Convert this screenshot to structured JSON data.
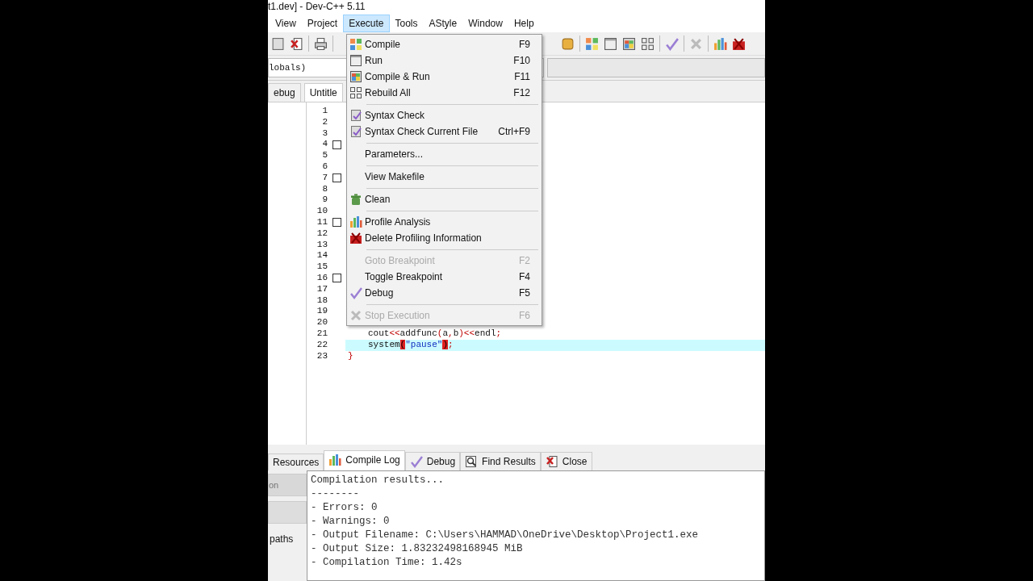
{
  "window": {
    "title": "t1.dev] - Dev-C++ 5.11"
  },
  "menu_bar": [
    {
      "label": "View",
      "selected": false
    },
    {
      "label": "Project",
      "selected": false
    },
    {
      "label": "Execute",
      "selected": true
    },
    {
      "label": "Tools",
      "selected": false
    },
    {
      "label": "AStyle",
      "selected": false
    },
    {
      "label": "Window",
      "selected": false
    },
    {
      "label": "Help",
      "selected": false
    }
  ],
  "scope_box": {
    "value": "lobals)"
  },
  "editor_tabs": [
    {
      "label": "ebug",
      "selected": false
    },
    {
      "label": "Untitle",
      "selected": true
    }
  ],
  "execute_menu": [
    {
      "kind": "item",
      "label": "Compile",
      "shortcut": "F9",
      "disabled": false
    },
    {
      "kind": "item",
      "label": "Run",
      "shortcut": "F10",
      "disabled": false
    },
    {
      "kind": "item",
      "label": "Compile & Run",
      "shortcut": "F11",
      "disabled": false
    },
    {
      "kind": "item",
      "label": "Rebuild All",
      "shortcut": "F12",
      "disabled": false
    },
    {
      "kind": "separator"
    },
    {
      "kind": "item",
      "label": "Syntax Check",
      "disabled": false
    },
    {
      "kind": "item",
      "label": "Syntax Check Current File",
      "shortcut": "Ctrl+F9",
      "disabled": false
    },
    {
      "kind": "separator"
    },
    {
      "kind": "item",
      "label": "Parameters...",
      "disabled": false
    },
    {
      "kind": "separator"
    },
    {
      "kind": "item",
      "label": "View Makefile",
      "disabled": false
    },
    {
      "kind": "separator"
    },
    {
      "kind": "item",
      "label": "Clean",
      "disabled": false
    },
    {
      "kind": "separator"
    },
    {
      "kind": "item",
      "label": "Profile Analysis",
      "disabled": false
    },
    {
      "kind": "item",
      "label": "Delete Profiling Information",
      "disabled": false
    },
    {
      "kind": "separator"
    },
    {
      "kind": "item",
      "label": "Goto Breakpoint",
      "shortcut": "F2",
      "disabled": true
    },
    {
      "kind": "item",
      "label": "Toggle Breakpoint",
      "shortcut": "F4",
      "disabled": false
    },
    {
      "kind": "item",
      "label": "Debug",
      "shortcut": "F5",
      "disabled": false
    },
    {
      "kind": "separator"
    },
    {
      "kind": "item",
      "label": "Stop Execution",
      "shortcut": "F6",
      "disabled": true
    }
  ],
  "editor": {
    "lines": [
      {
        "number": "1",
        "fold": false
      },
      {
        "number": "2",
        "fold": false
      },
      {
        "number": "3",
        "fold": false
      },
      {
        "number": "4",
        "fold": true
      },
      {
        "number": "5",
        "fold": false
      },
      {
        "number": "6",
        "fold": false
      },
      {
        "number": "7",
        "fold": true
      },
      {
        "number": "8",
        "fold": false
      },
      {
        "number": "9",
        "fold": false
      },
      {
        "number": "10",
        "fold": false
      },
      {
        "number": "11",
        "fold": true
      },
      {
        "number": "12",
        "fold": false
      },
      {
        "number": "13",
        "fold": false
      },
      {
        "number": "14",
        "fold": false
      },
      {
        "number": "15",
        "fold": false
      },
      {
        "number": "16",
        "fold": true
      },
      {
        "number": "17",
        "fold": false
      },
      {
        "number": "18",
        "fold": false
      },
      {
        "number": "19",
        "fold": false
      },
      {
        "number": "20",
        "fold": false
      },
      {
        "number": "21",
        "fold": false,
        "kind": "statement",
        "highlighted": false,
        "segments": [
          {
            "kind": "plain",
            "text": "cout"
          },
          {
            "kind": "op",
            "text": "<<"
          },
          {
            "kind": "plain",
            "text": "addfunc"
          },
          {
            "kind": "op",
            "text": "("
          },
          {
            "kind": "plain",
            "text": "a"
          },
          {
            "kind": "op",
            "text": ","
          },
          {
            "kind": "plain",
            "text": "b"
          },
          {
            "kind": "op",
            "text": ")<<"
          },
          {
            "kind": "plain",
            "text": "endl"
          },
          {
            "kind": "op",
            "text": ";"
          }
        ]
      },
      {
        "number": "22",
        "fold": false,
        "kind": "statement",
        "highlighted": true,
        "segments": [
          {
            "kind": "plain",
            "text": "system"
          },
          {
            "kind": "bracket",
            "text": "("
          },
          {
            "kind": "string",
            "text": "\"pause\""
          },
          {
            "kind": "bracket",
            "text": ")"
          },
          {
            "kind": "op",
            "text": ";"
          }
        ]
      },
      {
        "number": "23",
        "fold": false,
        "kind": "block_end",
        "highlighted": false,
        "segments": [
          {
            "kind": "op",
            "text": "}"
          }
        ]
      }
    ]
  },
  "bottom_tabs": [
    {
      "label": "Resources",
      "selected": false
    },
    {
      "label": "Compile Log",
      "selected": true
    },
    {
      "label": "Debug",
      "selected": false
    },
    {
      "label": "Find Results",
      "selected": false
    },
    {
      "label": "Close",
      "selected": false
    }
  ],
  "side_panel": {
    "button": {
      "label": "on",
      "disabled": true
    },
    "label": "paths"
  },
  "compile_log": [
    "Compilation results...",
    "--------",
    "- Errors: 0",
    "- Warnings: 0",
    "- Output Filename: C:\\Users\\HAMMAD\\OneDrive\\Desktop\\Project1.exe",
    "- Output Size: 1.83232498168945 MiB",
    "- Compilation Time: 1.42s"
  ]
}
